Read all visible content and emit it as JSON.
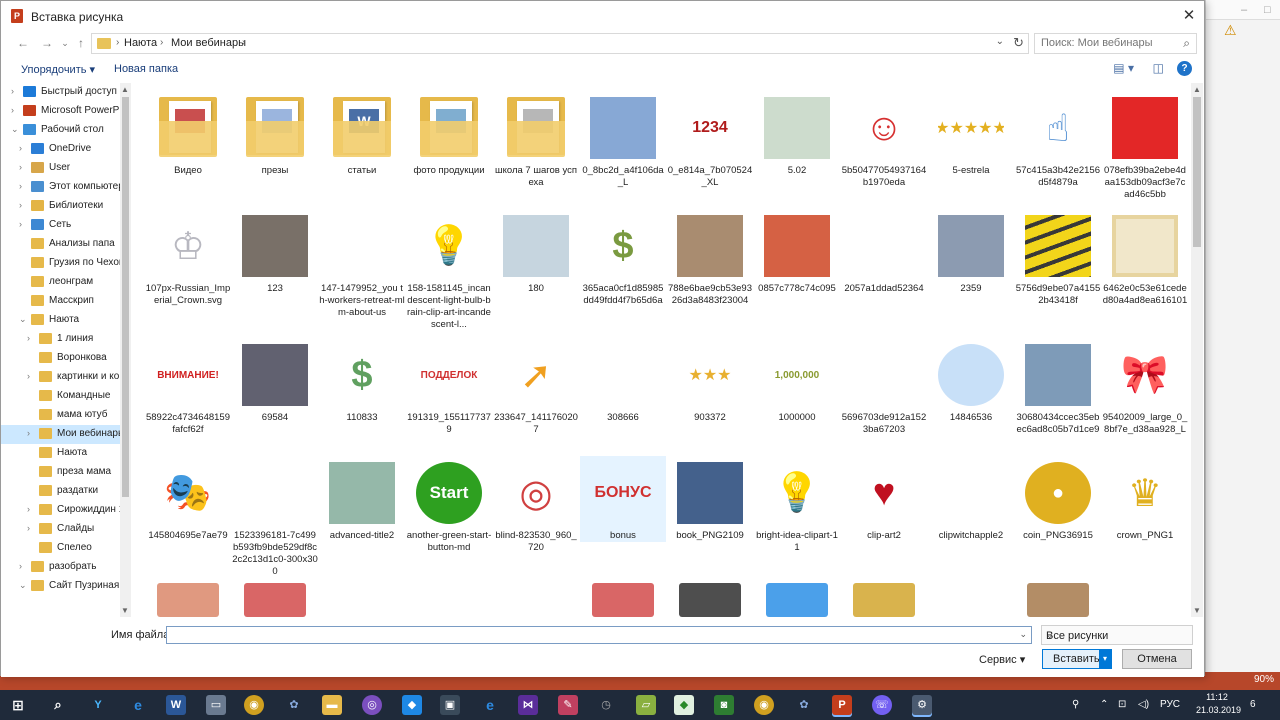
{
  "dialog": {
    "title": "Вставка рисунка",
    "close_glyph": "✕",
    "breadcrumb": [
      "Наюта",
      "Мои вебинары"
    ],
    "search_placeholder": "Поиск: Мои вебинары",
    "organize": "Упорядочить ▾",
    "new_folder": "Новая папка",
    "help": "?"
  },
  "tree": [
    {
      "label": "Быстрый доступ",
      "indent": 1,
      "icon": "star-icon",
      "color": "#1c7ad8",
      "arrow": "›"
    },
    {
      "label": "Microsoft PowerP",
      "indent": 1,
      "icon": "powerpoint-icon",
      "color": "#c43e1c",
      "arrow": "›"
    },
    {
      "label": "Рабочий стол",
      "indent": 1,
      "icon": "desktop-icon",
      "color": "#3a8fd9",
      "arrow": "⌄"
    },
    {
      "label": "OneDrive",
      "indent": 2,
      "icon": "cloud-icon",
      "color": "#2b7ed6",
      "arrow": "›"
    },
    {
      "label": "User",
      "indent": 2,
      "icon": "user-icon",
      "color": "#d7a64a",
      "arrow": "›"
    },
    {
      "label": "Этот компьютер",
      "indent": 2,
      "icon": "computer-icon",
      "color": "#4a8fd0",
      "arrow": "›"
    },
    {
      "label": "Библиотеки",
      "indent": 2,
      "icon": "library-icon",
      "color": "#e3b445",
      "arrow": "›"
    },
    {
      "label": "Сеть",
      "indent": 2,
      "icon": "network-icon",
      "color": "#3d88d3",
      "arrow": "›"
    },
    {
      "label": "Анализы папа",
      "indent": 2,
      "icon": "folder-icon",
      "color": "#e6b94a",
      "arrow": ""
    },
    {
      "label": "Грузия по Чехов",
      "indent": 2,
      "icon": "folder-icon",
      "color": "#e6b94a",
      "arrow": ""
    },
    {
      "label": "леонграм",
      "indent": 2,
      "icon": "folder-icon",
      "color": "#e6b94a",
      "arrow": ""
    },
    {
      "label": "Масскрип",
      "indent": 2,
      "icon": "folder-icon",
      "color": "#e6b94a",
      "arrow": ""
    },
    {
      "label": "Наюта",
      "indent": 2,
      "icon": "folder-icon",
      "color": "#e6b94a",
      "arrow": "⌄"
    },
    {
      "label": "1 линия",
      "indent": 3,
      "icon": "folder-icon",
      "color": "#e6b94a",
      "arrow": "›"
    },
    {
      "label": "Воронкова",
      "indent": 3,
      "icon": "folder-icon",
      "color": "#e6b94a",
      "arrow": ""
    },
    {
      "label": "картинки и ко",
      "indent": 3,
      "icon": "folder-icon",
      "color": "#e6b94a",
      "arrow": "›"
    },
    {
      "label": "Командные",
      "indent": 3,
      "icon": "folder-icon",
      "color": "#e6b94a",
      "arrow": ""
    },
    {
      "label": "мама ютуб",
      "indent": 3,
      "icon": "folder-icon",
      "color": "#e6b94a",
      "arrow": ""
    },
    {
      "label": "Мои вебинары",
      "indent": 3,
      "icon": "folder-icon",
      "color": "#e6b94a",
      "arrow": "›",
      "selected": true
    },
    {
      "label": "Наюта",
      "indent": 3,
      "icon": "folder-icon",
      "color": "#e6b94a",
      "arrow": ""
    },
    {
      "label": "преза мама",
      "indent": 3,
      "icon": "folder-icon",
      "color": "#e6b94a",
      "arrow": ""
    },
    {
      "label": "раздатки",
      "indent": 3,
      "icon": "folder-icon",
      "color": "#e6b94a",
      "arrow": ""
    },
    {
      "label": "Сирожиддин 1",
      "indent": 3,
      "icon": "folder-icon",
      "color": "#e6b94a",
      "arrow": "›"
    },
    {
      "label": "Слайды",
      "indent": 3,
      "icon": "folder-icon",
      "color": "#e6b94a",
      "arrow": "›"
    },
    {
      "label": "Спелео",
      "indent": 3,
      "icon": "folder-icon",
      "color": "#e6b94a",
      "arrow": ""
    },
    {
      "label": "разобрать",
      "indent": 2,
      "icon": "folder-icon",
      "color": "#e6b94a",
      "arrow": "›"
    },
    {
      "label": "Сайт Пузриная",
      "indent": 2,
      "icon": "folder-icon",
      "color": "#e6b94a",
      "arrow": "⌄"
    }
  ],
  "items": [
    {
      "name": "Видео",
      "kind": "folder",
      "icon": "folder-icon",
      "color": "#c03030"
    },
    {
      "name": "презы",
      "kind": "folder",
      "icon": "folder-icon",
      "color": "#8aa8d8"
    },
    {
      "name": "статьи",
      "kind": "folder",
      "icon": "folder-icon",
      "color": "#2b5797",
      "glyph": "W"
    },
    {
      "name": "фото продукции",
      "kind": "folder",
      "icon": "folder-icon",
      "color": "#6aa0c8"
    },
    {
      "name": "школа 7 шагов успеха",
      "kind": "folder",
      "icon": "folder-icon",
      "color": "#aaaaaa"
    },
    {
      "name": "0_8bc2d_a4f106da_L",
      "kind": "image",
      "icon": "books-icon",
      "color": "#7a9fd0"
    },
    {
      "name": "0_e814a_7b070524_XL",
      "kind": "image",
      "icon": "numbers-icon",
      "color": "#b01c1c",
      "glyph": "1234"
    },
    {
      "name": "5.02",
      "kind": "image",
      "icon": "diagram-icon",
      "color": "#c8d8c8"
    },
    {
      "name": "5b50477054937164b1970eda",
      "kind": "image",
      "icon": "clock-character-icon",
      "color": "#d63030",
      "glyph": "☺"
    },
    {
      "name": "5-estrela",
      "kind": "image",
      "icon": "stars-icon",
      "color": "#e3b020",
      "glyph": "★★★★★"
    },
    {
      "name": "57c415a3b42e2156d5f4879a",
      "kind": "image",
      "icon": "pointing-hand-icon",
      "color": "#4a8ad0",
      "glyph": "☝"
    },
    {
      "name": "078efb39ba2ebe4daa153db09acf3e7cad46c5bb",
      "kind": "image",
      "icon": "red-rectangle-icon",
      "color": "#e01010"
    },
    {
      "name": "107px-Russian_Imperial_Crown.svg",
      "kind": "image",
      "icon": "crown-icon",
      "color": "#b8b8c0",
      "glyph": "♔"
    },
    {
      "name": "123",
      "kind": "image",
      "icon": "photo-icon",
      "color": "#6a6058"
    },
    {
      "name": "147-1479952_you th-workers-retreat-mlm-about-us",
      "kind": "image",
      "icon": "network-people-icon",
      "color": "#d09040"
    },
    {
      "name": "158-1581145_incandescent-light-bulb-brain-clip-art-incandescent-l...",
      "kind": "image",
      "icon": "lightbulb-icon",
      "color": "#f5c518",
      "glyph": "💡"
    },
    {
      "name": "180",
      "kind": "image",
      "icon": "diagram-icon",
      "color": "#c0d0dc"
    },
    {
      "name": "365aca0cf1d85985dd49fdd4f7b65d6a",
      "kind": "image",
      "icon": "money-bag-icon",
      "color": "#7a9a40",
      "glyph": "$"
    },
    {
      "name": "788e6bae9cb53e9326d3a8483f23004",
      "kind": "image",
      "icon": "photo-icon",
      "color": "#a08060"
    },
    {
      "name": "0857c778c74c095",
      "kind": "image",
      "icon": "books-icon",
      "color": "#d05030"
    },
    {
      "name": "2057a1ddad52364",
      "kind": "image",
      "icon": "lightbulb-icon",
      "color": "#9ad040"
    },
    {
      "name": "2359",
      "kind": "image",
      "icon": "photo-icon",
      "color": "#8090a8"
    },
    {
      "name": "5756d9ebe07a41552b43418f",
      "kind": "image",
      "icon": "caution-tape-icon",
      "color": "#f0d000"
    },
    {
      "name": "6462e0c53e61ceded80a4ad8ea616101",
      "kind": "image",
      "icon": "frame-icon",
      "color": "#e8d8a8"
    },
    {
      "name": "58922c4734648159fafcf62f",
      "kind": "image",
      "icon": "warning-label-icon",
      "color": "#d02020",
      "glyph": "ВНИМАНИЕ!"
    },
    {
      "name": "69584",
      "kind": "image",
      "icon": "photo-icon",
      "color": "#505060"
    },
    {
      "name": "110833",
      "kind": "image",
      "icon": "money-icon",
      "color": "#60a060",
      "glyph": "$"
    },
    {
      "name": "191319_1551177379",
      "kind": "image",
      "icon": "stamp-icon",
      "color": "#d03030",
      "glyph": "ПОДДЕЛОК"
    },
    {
      "name": "233647_1411760207",
      "kind": "image",
      "icon": "arrow-man-icon",
      "color": "#f0a020",
      "glyph": "➚"
    },
    {
      "name": "308666",
      "kind": "image",
      "icon": "wheat-icon",
      "color": "#d8b060"
    },
    {
      "name": "903372",
      "kind": "image",
      "icon": "stars-icon",
      "color": "#e8b030",
      "glyph": "★★★"
    },
    {
      "name": "1000000",
      "kind": "image",
      "icon": "million-text-icon",
      "color": "#8a9a30",
      "glyph": "1,000,000"
    },
    {
      "name": "5696703de912a1523ba67203",
      "kind": "image",
      "icon": "sparkle-icon",
      "color": "#70c8e0"
    },
    {
      "name": "14846536",
      "kind": "image",
      "icon": "bubble-icon",
      "color": "#c8e0f8"
    },
    {
      "name": "30680434ccec35ebec6ad8c05b7d1ce9",
      "kind": "image",
      "icon": "photo-icon",
      "color": "#7090b0"
    },
    {
      "name": "95402009_large_0_8bf7e_d38aa928_L",
      "kind": "image",
      "icon": "clock-bow-icon",
      "color": "#d04040",
      "glyph": "🎀"
    },
    {
      "name": "145804695e7ae79",
      "kind": "image",
      "icon": "carnival-mask-icon",
      "color": "#e070b0",
      "glyph": "🎭"
    },
    {
      "name": "1523396181-7c499b593fb9bde529df8c2c2c13d1c0-300x300",
      "kind": "image",
      "icon": "hand-shake-icon",
      "color": "#b0a080"
    },
    {
      "name": "advanced-title2",
      "kind": "image",
      "icon": "diagram-icon",
      "color": "#8ab0a0"
    },
    {
      "name": "another-green-start-button-md",
      "kind": "image",
      "icon": "start-button-icon",
      "color": "#2ea020",
      "glyph": "Start"
    },
    {
      "name": "blind-823530_960_720",
      "kind": "image",
      "icon": "target-icon",
      "color": "#d04040",
      "glyph": "◎"
    },
    {
      "name": "bonus",
      "kind": "image",
      "icon": "bonus-stamp-icon",
      "color": "#d03030",
      "glyph": "БОНУС",
      "hover": true
    },
    {
      "name": "book_PNG2109",
      "kind": "image",
      "icon": "book-icon",
      "color": "#305080"
    },
    {
      "name": "bright-idea-clipart-11",
      "kind": "image",
      "icon": "lightbulb-icon",
      "color": "#f0c020",
      "glyph": "💡"
    },
    {
      "name": "clip-art2",
      "kind": "image",
      "icon": "heart-icon",
      "color": "#c01020",
      "glyph": "♥"
    },
    {
      "name": "clipwitchapple2",
      "kind": "image",
      "icon": "witch-icon",
      "color": "#303030"
    },
    {
      "name": "coin_PNG36915",
      "kind": "image",
      "icon": "coin-icon",
      "color": "#e0b020",
      "glyph": "●"
    },
    {
      "name": "crown_PNG1",
      "kind": "image",
      "icon": "crown-icon",
      "color": "#e0b020",
      "glyph": "♛"
    }
  ],
  "bottom": {
    "filename_label": "Имя файла:",
    "filename_value": "",
    "filetype": "Все рисунки",
    "service": "Сервис ▾",
    "insert": "Вставить",
    "cancel": "Отмена"
  },
  "taskbar": {
    "lang": "РУС",
    "time": "11:12",
    "date": "21.03.2019",
    "notification_count": "6",
    "zoom": "90%"
  },
  "colors": {
    "accent": "#0078d7",
    "ppt": "#b7472a",
    "taskbar": "#1f2a3a"
  }
}
